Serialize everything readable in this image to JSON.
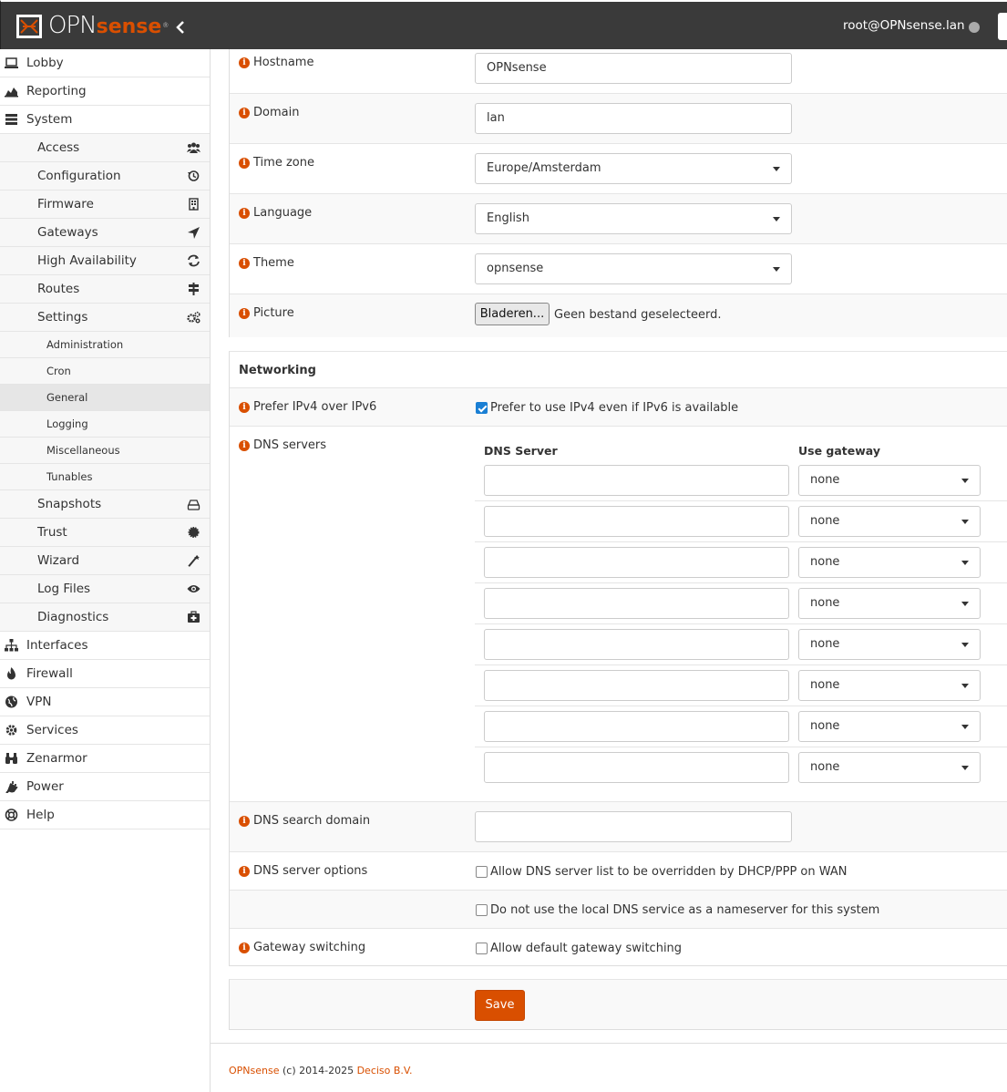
{
  "header": {
    "logo_text_a": "OPN",
    "logo_text_b": "sense",
    "logo_reg": "®",
    "user": "root@OPNsense.lan"
  },
  "sidebar": {
    "top": [
      {
        "label": "Lobby",
        "icon": "laptop-icon"
      },
      {
        "label": "Reporting",
        "icon": "area-chart-icon"
      },
      {
        "label": "System",
        "icon": "server-icon"
      }
    ],
    "system_items": [
      {
        "label": "Access",
        "icon": "users-icon"
      },
      {
        "label": "Configuration",
        "icon": "history-icon"
      },
      {
        "label": "Firmware",
        "icon": "building-icon"
      },
      {
        "label": "Gateways",
        "icon": "location-arrow-icon"
      },
      {
        "label": "High Availability",
        "icon": "refresh-icon"
      },
      {
        "label": "Routes",
        "icon": "map-signs-icon"
      },
      {
        "label": "Settings",
        "icon": "cogs-icon"
      }
    ],
    "settings_items": [
      "Administration",
      "Cron",
      "General",
      "Logging",
      "Miscellaneous",
      "Tunables"
    ],
    "active_setting": "General",
    "system_items_b": [
      {
        "label": "Snapshots",
        "icon": "hdd-icon"
      },
      {
        "label": "Trust",
        "icon": "certificate-icon"
      },
      {
        "label": "Wizard",
        "icon": "magic-icon"
      },
      {
        "label": "Log Files",
        "icon": "eye-icon"
      },
      {
        "label": "Diagnostics",
        "icon": "medkit-icon"
      }
    ],
    "bottom": [
      {
        "label": "Interfaces",
        "icon": "sitemap-icon"
      },
      {
        "label": "Firewall",
        "icon": "fire-icon"
      },
      {
        "label": "VPN",
        "icon": "globe-icon"
      },
      {
        "label": "Services",
        "icon": "cog-icon"
      },
      {
        "label": "Zenarmor",
        "icon": "binoculars-icon"
      },
      {
        "label": "Power",
        "icon": "plug-icon"
      },
      {
        "label": "Help",
        "icon": "life-ring-icon"
      }
    ]
  },
  "form": {
    "hostname_label": "Hostname",
    "hostname_value": "OPNsense",
    "domain_label": "Domain",
    "domain_value": "lan",
    "timezone_label": "Time zone",
    "timezone_value": "Europe/Amsterdam",
    "language_label": "Language",
    "language_value": "English",
    "theme_label": "Theme",
    "theme_value": "opnsense",
    "picture_label": "Picture",
    "browse_label": "Bladeren...",
    "no_file": "Geen bestand geselecteerd.",
    "networking_title": "Networking",
    "prefer_label": "Prefer IPv4 over IPv6",
    "prefer_check": "Prefer to use IPv4 even if IPv6 is available",
    "prefer_checked": true,
    "dns_label": "DNS servers",
    "dns_head_server": "DNS Server",
    "dns_head_gateway": "Use gateway",
    "dns_rows": [
      "none",
      "none",
      "none",
      "none",
      "none",
      "none",
      "none",
      "none"
    ],
    "search_domain_label": "DNS search domain",
    "dns_options_label": "DNS server options",
    "dns_opt1": "Allow DNS server list to be overridden by DHCP/PPP on WAN",
    "dns_opt2": "Do not use the local DNS service as a nameserver for this system",
    "gw_switch_label": "Gateway switching",
    "gw_switch_check": "Allow default gateway switching",
    "save_label": "Save"
  },
  "footer": {
    "brand": "OPNsense",
    "copy": " (c) 2014-2025 ",
    "company": "Deciso B.V."
  },
  "colors": {
    "accent": "#d94f00",
    "header_bg": "#3a3a3a",
    "checkbox_on": "#1a7fd4"
  }
}
